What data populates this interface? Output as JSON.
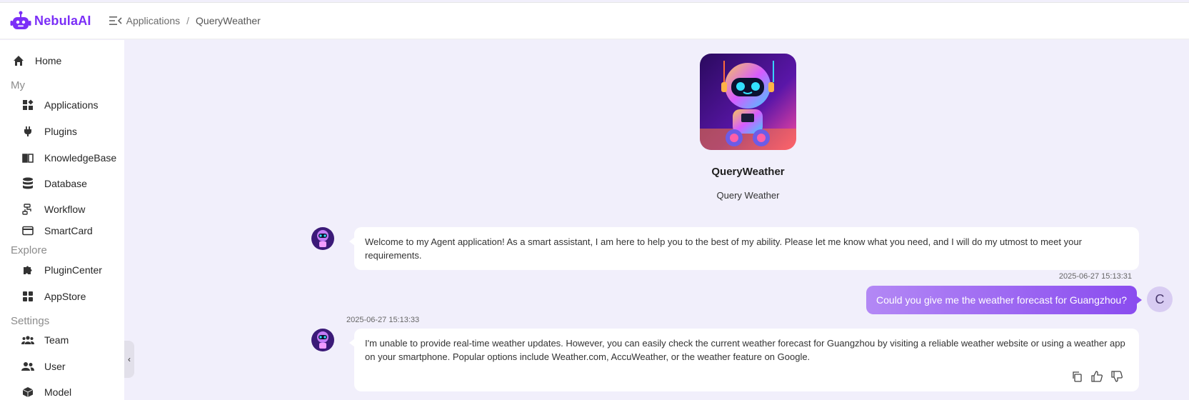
{
  "brand": {
    "name": "NebulaAI",
    "color": "#7b2ff7"
  },
  "breadcrumb": {
    "parent": "Applications",
    "separator": "/",
    "current": "QueryWeather"
  },
  "sidebar": {
    "home": "Home",
    "sections": {
      "my": "My",
      "explore": "Explore",
      "settings": "Settings"
    },
    "my_items": [
      "Applications",
      "Plugins",
      "KnowledgeBase",
      "Database",
      "Workflow",
      "SmartCard"
    ],
    "explore_items": [
      "PluginCenter",
      "AppStore"
    ],
    "settings_items": [
      "Team",
      "User",
      "Model"
    ],
    "toggle_glyph": "‹"
  },
  "agent": {
    "name": "QueryWeather",
    "description": "Query Weather"
  },
  "chat": {
    "messages": [
      {
        "role": "bot",
        "text": "Welcome to my Agent application! As a smart assistant, I am here to help you to the best of my ability. Please let me know what you need, and I will do my utmost to meet your requirements."
      },
      {
        "role": "user",
        "timestamp": "2025-06-27 15:13:31",
        "text": "Could you give me the weather forecast for Guangzhou?",
        "avatar_letter": "C"
      },
      {
        "role": "bot",
        "timestamp": "2025-06-27 15:13:33",
        "text": "I'm unable to provide real-time weather updates. However, you can easily check the current weather forecast for Guangzhou by visiting a reliable weather website or using a weather app on your smartphone. Popular options include Weather.com, AccuWeather, or the weather feature on Google."
      }
    ]
  },
  "colors": {
    "background": "#f1effb",
    "user_bubble_start": "#b388f5",
    "user_bubble_end": "#8a4cef"
  }
}
